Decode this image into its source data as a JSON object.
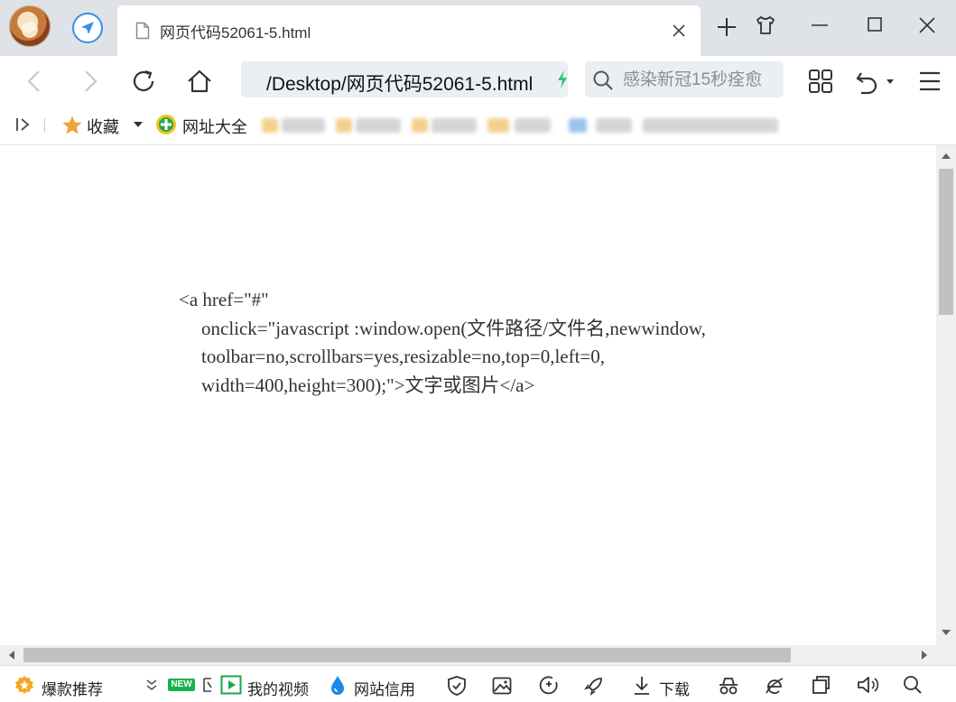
{
  "tab": {
    "title": "网页代码52061-5.html",
    "close_glyph": "✕"
  },
  "address_bar": {
    "url": "/Desktop/网页代码52061-5.html"
  },
  "search": {
    "placeholder": "感染新冠15秒痊愈"
  },
  "bookmarks": {
    "favorites_label": "收藏",
    "site_nav_label": "网址大全"
  },
  "content": {
    "code_lines": [
      "<a href=\"#\"",
      "onclick=\"javascript :window.open(文件路径/文件名,newwindow,",
      "toolbar=no,scrollbars=yes,resizable=no,top=0,left=0,",
      "width=400,height=300);\">文字或图片</a>"
    ]
  },
  "statusbar": {
    "hot_label": "爆款推荐",
    "new_badge": "NEW",
    "video_label": "我的视频",
    "credit_label": "网站信用",
    "download_label": "下载"
  },
  "colors": {
    "tab_strip_bg": "#dfe3e8",
    "accent_blue": "#3a8ee6",
    "star_orange": "#f2a23a",
    "new_green": "#17b34a"
  },
  "icons": [
    "page-icon",
    "close-icon",
    "plus-icon",
    "shirt-icon",
    "minimize-icon",
    "maximize-icon",
    "window-close-icon",
    "back-icon",
    "forward-icon",
    "refresh-icon",
    "home-icon",
    "bolt-icon",
    "search-icon",
    "apps-grid-icon",
    "undo-icon",
    "menu-icon",
    "sidebar-collapse-icon",
    "star-icon",
    "site-nav-icon"
  ]
}
